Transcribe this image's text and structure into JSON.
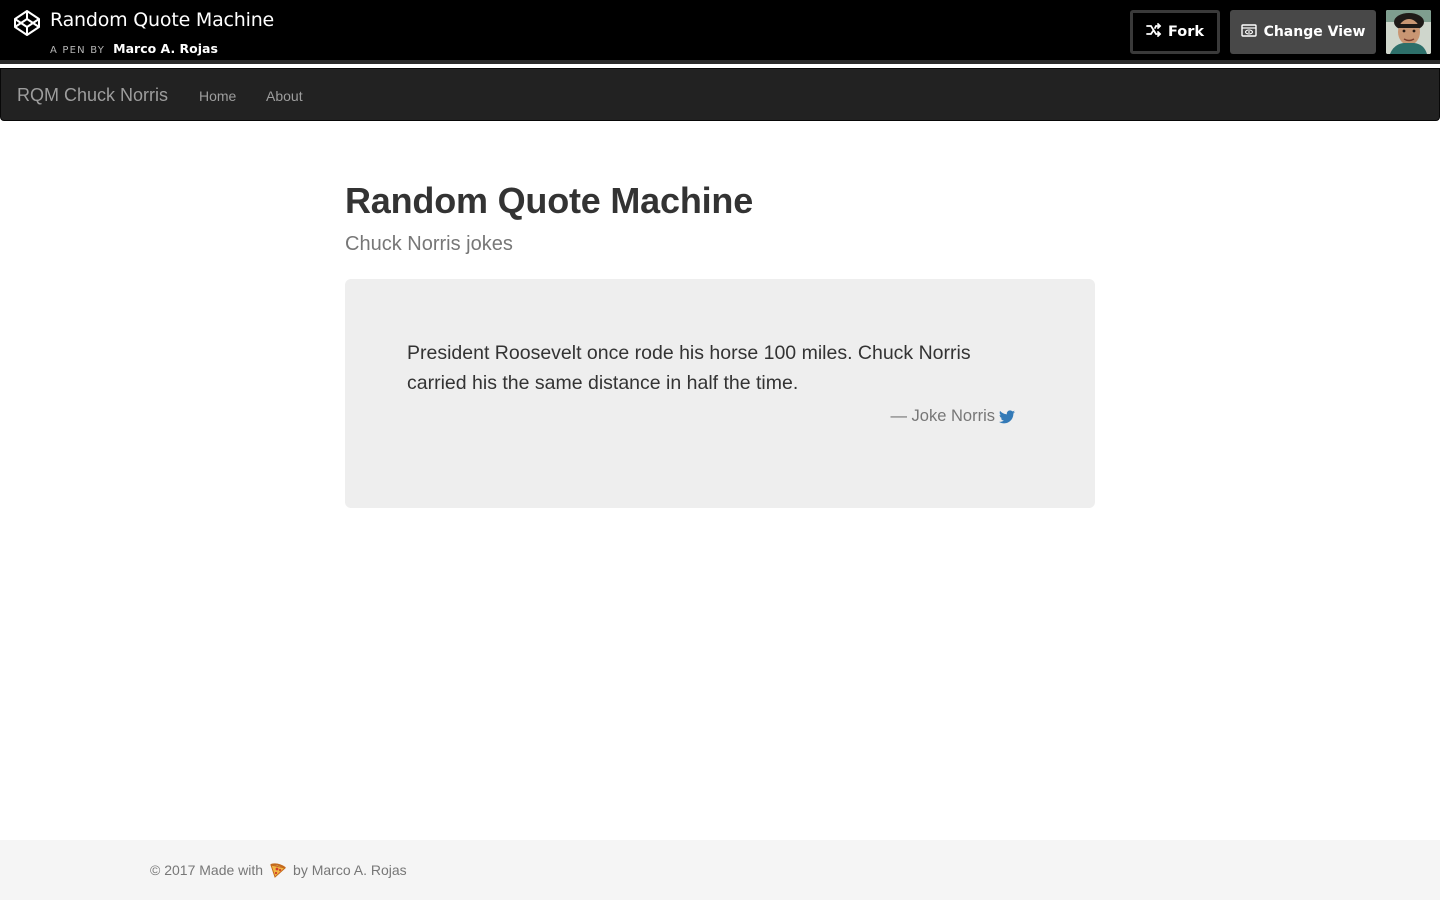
{
  "codepen": {
    "pen_title": "Random Quote Machine",
    "byline_prefix": "A PEN BY",
    "author": "Marco A. Rojas",
    "fork_label": "Fork",
    "change_view_label": "Change View",
    "icons": {
      "logo": "codepen-logo-icon",
      "fork": "fork-icon",
      "view": "change-view-icon"
    }
  },
  "navbar": {
    "brand": "RQM Chuck Norris",
    "links": [
      "Home",
      "About"
    ]
  },
  "main": {
    "title": "Random Quote Machine",
    "subtitle": "Chuck Norris jokes",
    "quote": {
      "text": "President Roosevelt once rode his horse 100 miles. Chuck Norris carried his the same distance in half the time.",
      "attribution": "— Joke Norris",
      "share_icon": "twitter-icon"
    }
  },
  "footer": {
    "text_before": "© 2017 Made with",
    "icon": "pizza-icon",
    "text_after": "by Marco A. Rojas"
  },
  "colors": {
    "codepen_bar": "#000000",
    "navbar_bg": "#222222",
    "nav_text": "#9d9d9d",
    "well_bg": "#eeeeee",
    "twitter_blue": "#337ab7",
    "footer_bg": "#f5f5f5"
  }
}
